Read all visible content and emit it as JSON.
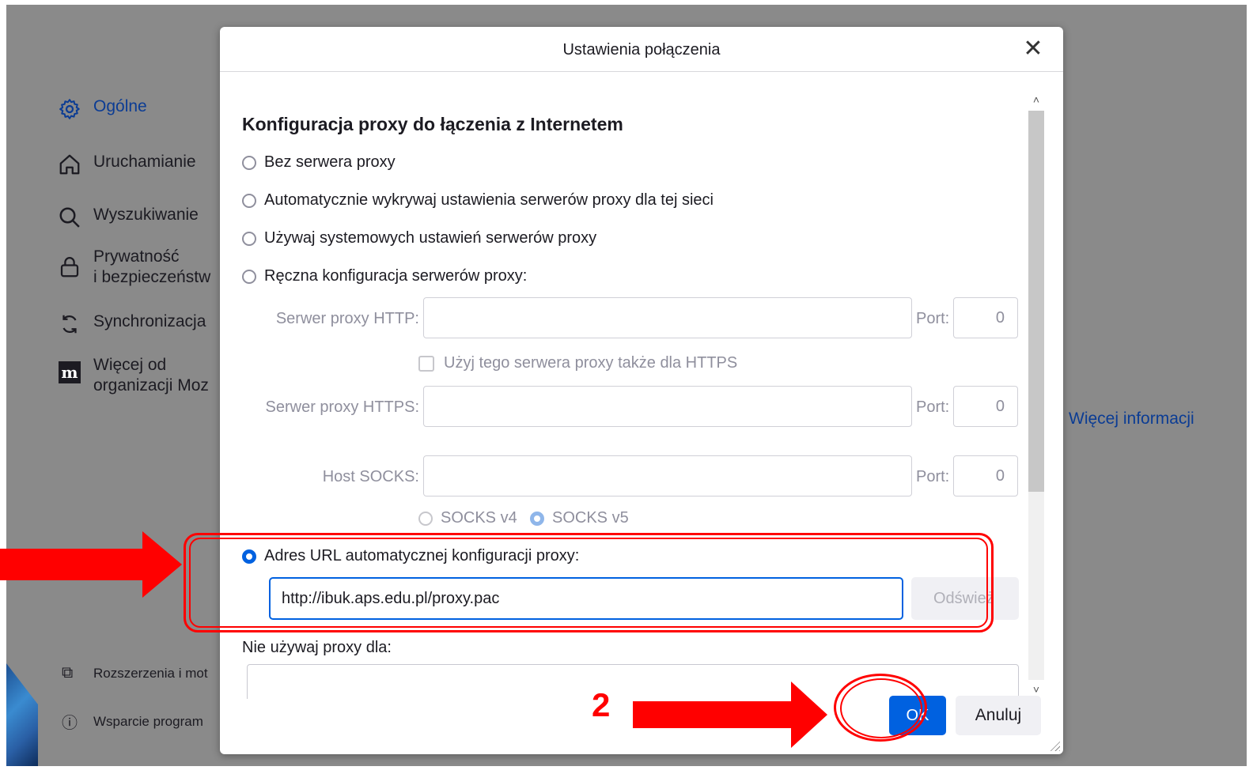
{
  "sidebar": {
    "items": [
      {
        "icon": "gear-icon",
        "label": "Ogólne"
      },
      {
        "icon": "home-icon",
        "label": "Uruchamianie"
      },
      {
        "icon": "search-icon",
        "label": "Wyszukiwanie"
      },
      {
        "icon": "lock-icon",
        "label": "Prywatność\ni bezpieczeństw"
      },
      {
        "icon": "sync-icon",
        "label": "Synchronizacja"
      },
      {
        "icon": "mozilla-icon",
        "label": "Więcej od\norganizacji Moz"
      }
    ],
    "bottom": [
      {
        "icon": "puzzle-icon",
        "label": "Rozszerzenia i mot"
      },
      {
        "icon": "help-icon",
        "label": "Wsparcie program"
      }
    ]
  },
  "background": {
    "more_info_link": "Więcej informacji"
  },
  "dialog": {
    "title": "Ustawienia połączenia",
    "section_title": "Konfiguracja proxy do łączenia z Internetem",
    "options": {
      "no_proxy": "Bez serwera proxy",
      "auto_detect": "Automatycznie wykrywaj ustawienia serwerów proxy dla tej sieci",
      "system": "Używaj systemowych ustawień serwerów proxy",
      "manual": "Ręczna konfiguracja serwerów proxy:",
      "auto_url": "Adres URL automatycznej konfiguracji proxy:"
    },
    "selected_option": "auto_url",
    "http_label": "Serwer proxy HTTP:",
    "https_label": "Serwer proxy HTTPS:",
    "socks_label": "Host SOCKS:",
    "port_label": "Port:",
    "http_port": "0",
    "https_port": "0",
    "socks_port": "0",
    "use_for_https": "Użyj tego serwera proxy także dla HTTPS",
    "socks_v4": "SOCKS v4",
    "socks_v5": "SOCKS v5",
    "socks_selected": "v5",
    "pac_url": "http://ibuk.aps.edu.pl/proxy.pac",
    "reload_button": "Odśwież",
    "no_proxy_for": "Nie używaj proxy dla:",
    "ok_button": "OK",
    "cancel_button": "Anuluj"
  },
  "annotations": {
    "step_number": "2",
    "color": "#ff0000"
  },
  "colors": {
    "accent": "#0061e0",
    "overlay": "#8a8a8a",
    "annotation": "#ff0000"
  }
}
